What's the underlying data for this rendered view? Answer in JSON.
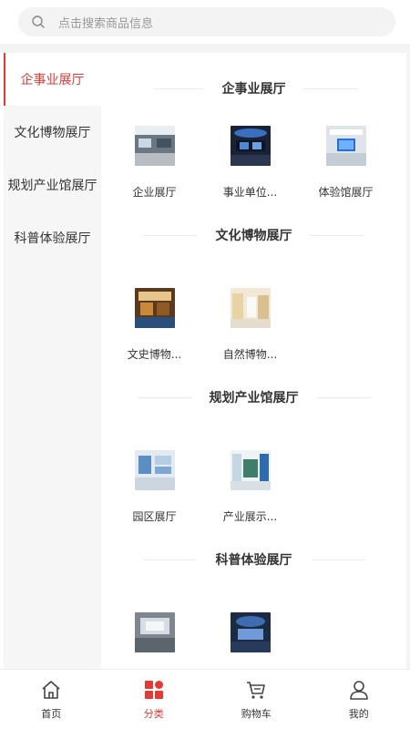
{
  "search": {
    "placeholder": "点击搜索商品信息"
  },
  "sidebar": {
    "items": [
      {
        "label": "企事业展厅",
        "active": true
      },
      {
        "label": "文化博物展厅",
        "active": false
      },
      {
        "label": "规划产业馆展厅",
        "active": false
      },
      {
        "label": "科普体验展厅",
        "active": false
      }
    ]
  },
  "sections": [
    {
      "title": "企事业展厅",
      "items": [
        {
          "label": "企业展厅",
          "thumb": "hall-gray"
        },
        {
          "label": "事业单位...",
          "thumb": "hall-dark-blue"
        },
        {
          "label": "体验馆展厅",
          "thumb": "hall-white-blue"
        }
      ]
    },
    {
      "title": "文化博物展厅",
      "items": [
        {
          "label": "文史博物...",
          "thumb": "museum-warm"
        },
        {
          "label": "自然博物...",
          "thumb": "museum-light"
        }
      ]
    },
    {
      "title": "规划产业馆展厅",
      "items": [
        {
          "label": "园区展厅",
          "thumb": "park-blue"
        },
        {
          "label": "产业展示...",
          "thumb": "industry-bright"
        }
      ]
    },
    {
      "title": "科普体验展厅",
      "items": [
        {
          "label": "",
          "thumb": "science-gray"
        },
        {
          "label": "",
          "thumb": "science-dark"
        }
      ]
    }
  ],
  "tabbar": {
    "items": [
      {
        "label": "首页",
        "icon": "home-icon",
        "active": false
      },
      {
        "label": "分类",
        "icon": "category-icon",
        "active": true
      },
      {
        "label": "购物车",
        "icon": "cart-icon",
        "active": false
      },
      {
        "label": "我的",
        "icon": "user-icon",
        "active": false
      }
    ]
  },
  "colors": {
    "accent": "#e53935",
    "sidebar_bg": "#f6f6f6"
  }
}
